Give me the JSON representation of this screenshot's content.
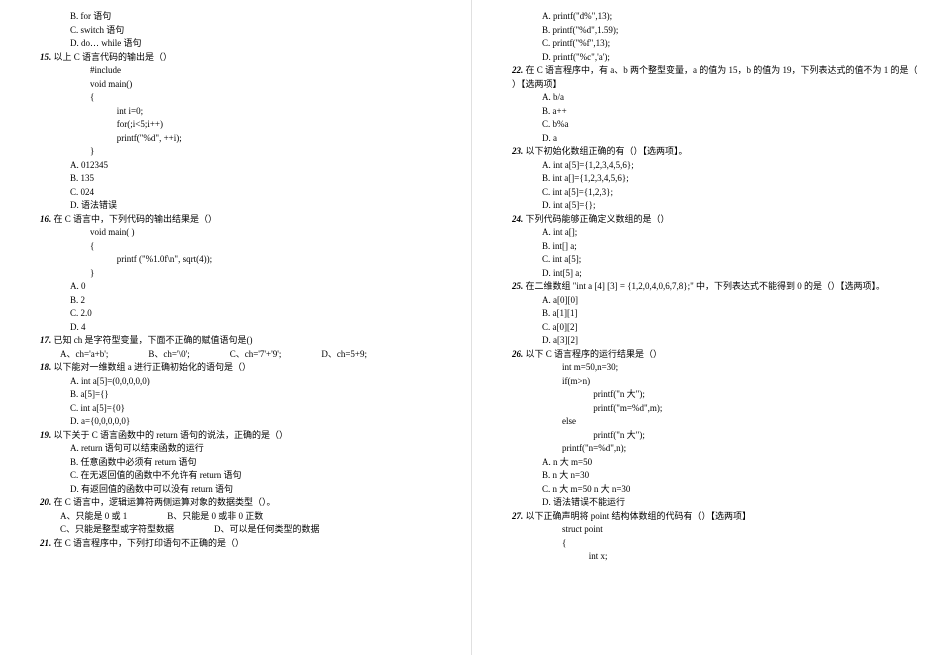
{
  "left": {
    "pre": [
      "B.  for 语句",
      "C.  switch 语句",
      "D.  do… while 语句"
    ],
    "q15": {
      "num": "15.",
      "title": "以上 C 语言代码的输出是（）",
      "code": [
        "#include",
        "void main()",
        "{",
        "   int i=0;",
        "   for(;i<5;i++)",
        "   printf(\"%d\", ++i);",
        "}"
      ],
      "opts": [
        "A.  012345",
        "B.  135",
        "C.  024",
        "D.  语法错误"
      ]
    },
    "q16": {
      "num": "16.",
      "title": "在 C 语言中，下列代码的输出结果是（）",
      "code": [
        "void main( )",
        "{",
        "   printf (\"%1.0f\\n\", sqrt(4));",
        "}"
      ],
      "opts": [
        "A.  0",
        "B.  2",
        "C.  2.0",
        "D.  4"
      ]
    },
    "q17": {
      "num": "17.",
      "title": "已知 ch 是字符型变量，下面不正确的赋值语句是()",
      "opts": [
        "A、ch='a+b';",
        "B、ch='\\0';",
        "C、ch='7'+'9';",
        "D、ch=5+9;"
      ]
    },
    "q18": {
      "num": "18.",
      "title": "以下能对一维数组 a 进行正确初始化的语句是（）",
      "opts": [
        "A.  int a[5]=(0,0,0,0,0)",
        "B.  a[5]={}",
        "C.  int a[5]={0}",
        "D.  a={0,0,0,0,0}"
      ]
    },
    "q19": {
      "num": "19.",
      "title": "以下关于 C 语言函数中的 return 语句的说法，正确的是（）",
      "opts": [
        "A.  return 语句可以结束函数的运行",
        "B.  任意函数中必须有 return 语句",
        "C.  在无返回值的函数中不允许有 return 语句",
        "D.  有返回值的函数中可以没有 return 语句"
      ]
    },
    "q20": {
      "num": "20.",
      "title": "在 C 语言中，逻辑运算符两侧运算对象的数据类型（）。",
      "opts": [
        "A、只能是 0 或 1",
        "B、只能是 0 或非 0 正数",
        "C、只能是整型或字符型数据",
        "D、可以是任何类型的数据"
      ]
    },
    "q21": {
      "num": "21.",
      "title": "在 C 语言程序中，下列打印语句不正确的是（）"
    }
  },
  "right": {
    "pre": [
      "A.  printf(\"d%\",13);",
      "B.  printf(\"%d\",1.59);",
      "C.  printf(\"%f\",13);",
      "D.  printf(\"%c\",'a');"
    ],
    "q22": {
      "num": "22.",
      "title": "在 C 语言程序中，有 a、b 两个整型变量，a 的值为 15，b 的值为 19，下列表达式的值不为 1 的是（  ）【选两项】",
      "opts": [
        "A.  b/a",
        "B.  a++",
        "C.  b%a",
        "D.  a"
      ]
    },
    "q23": {
      "num": "23.",
      "title": "以下初始化数组正确的有（）【选两项】。",
      "opts": [
        "A.  int a[5]={1,2,3,4,5,6};",
        "B.  int a[]={1,2,3,4,5,6};",
        "C.  int a[5]={1,2,3};",
        "D.  int a[5]={};"
      ]
    },
    "q24": {
      "num": "24.",
      "title": "下列代码能够正确定义数组的是（）",
      "opts": [
        "A.  int a[];",
        "B.  int[] a;",
        "C.  int a[5];",
        "D.  int[5] a;"
      ]
    },
    "q25": {
      "num": "25.",
      "title": "在二维数组 \"int a [4]  [3] = {1,2,0,4,0,6,7,8};\" 中，下列表达式不能得到 0 的是（）【选两项】。",
      "opts": [
        "A.  a[0][0]",
        "B.  a[1][1]",
        "C.  a[0][2]",
        "D.  a[3][2]"
      ]
    },
    "q26": {
      "num": "26.",
      "title": "以下 C 语言程序的运行结果是（）",
      "code": [
        "int m=50,n=30;",
        "if(m>n)",
        "     printf(\"n 大\");",
        "     printf(\"m=%d\",m);",
        "else",
        "     printf(\"n 大\");",
        "printf(\"n=%d\",n);"
      ],
      "opts": [
        "A.  n 大 m=50",
        "B.  n 大 n=30",
        "C.  n 大 m=50 n 大 n=30",
        "D.  语法错误不能运行"
      ]
    },
    "q27": {
      "num": "27.",
      "title": "以下正确声明将 point 结构体数组的代码有（）【选两项】",
      "code": [
        "struct point",
        "{",
        "   int x;"
      ]
    }
  }
}
